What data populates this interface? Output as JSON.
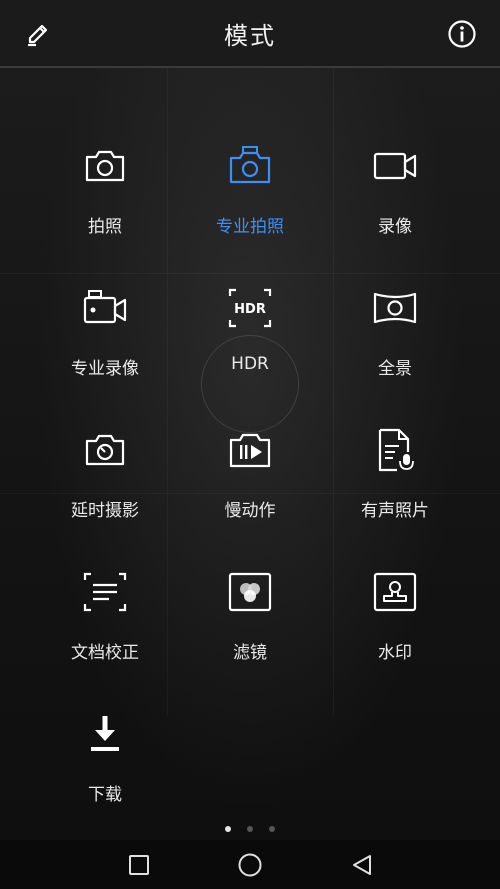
{
  "header": {
    "title": "模式",
    "edit_icon": "pencil-icon",
    "info_icon": "info-icon"
  },
  "modes": [
    {
      "label": "拍照",
      "icon": "camera-icon",
      "active": false
    },
    {
      "label": "专业拍照",
      "icon": "pro-camera-icon",
      "active": true
    },
    {
      "label": "录像",
      "icon": "video-camera-icon",
      "active": false
    },
    {
      "label": "专业录像",
      "icon": "pro-video-icon",
      "active": false
    },
    {
      "label": "HDR",
      "icon": "hdr-icon",
      "active": false
    },
    {
      "label": "全景",
      "icon": "panorama-icon",
      "active": false
    },
    {
      "label": "延时摄影",
      "icon": "timelapse-icon",
      "active": false
    },
    {
      "label": "慢动作",
      "icon": "slow-motion-icon",
      "active": false
    },
    {
      "label": "有声照片",
      "icon": "audio-photo-icon",
      "active": false
    },
    {
      "label": "文档校正",
      "icon": "document-scan-icon",
      "active": false
    },
    {
      "label": "滤镜",
      "icon": "filter-icon",
      "active": false
    },
    {
      "label": "水印",
      "icon": "watermark-icon",
      "active": false
    },
    {
      "label": "下载",
      "icon": "download-icon",
      "active": false
    }
  ],
  "hdr_badge": "HDR",
  "pager": {
    "pages": 3,
    "current": 1
  },
  "colors": {
    "accent": "#3d8ff5",
    "text": "#eaeaea",
    "background": "#141414"
  }
}
